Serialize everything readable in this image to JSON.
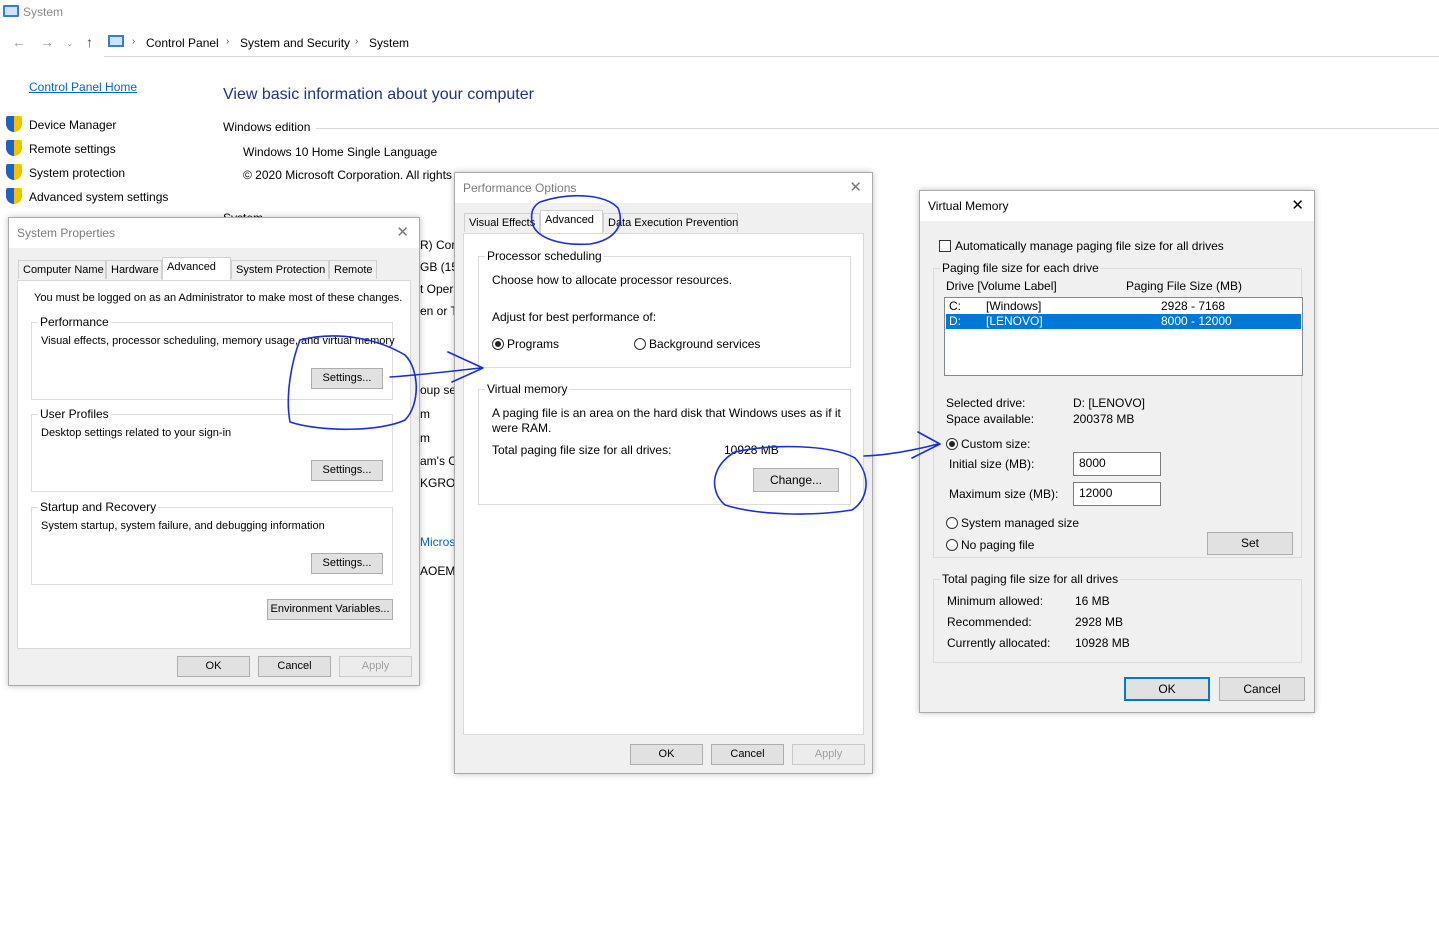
{
  "window": {
    "title": "System",
    "breadcrumb": [
      "Control Panel",
      "System and Security",
      "System"
    ],
    "breadcrumb_sep": "›"
  },
  "sidebar": {
    "home": "Control Panel Home",
    "items": [
      {
        "label": "Device Manager",
        "icon": "shield-icon"
      },
      {
        "label": "Remote settings",
        "icon": "shield-icon"
      },
      {
        "label": "System protection",
        "icon": "shield-icon"
      },
      {
        "label": "Advanced system settings",
        "icon": "shield-icon"
      }
    ]
  },
  "main": {
    "title": "View basic information about your computer",
    "windows_edition_label": "Windows edition",
    "edition": "Windows 10 Home Single Language",
    "copyright": "© 2020 Microsoft Corporation. All rights",
    "system_label": "System",
    "peek": [
      "R) Cor",
      "GB (15.",
      "t Opera",
      "en or T",
      "oup se",
      "m",
      "m",
      "am's C",
      "KGROU",
      "Microso",
      "AOEM"
    ]
  },
  "system_properties": {
    "title": "System Properties",
    "tabs": [
      "Computer Name",
      "Hardware",
      "Advanced",
      "System Protection",
      "Remote"
    ],
    "notice": "You must be logged on as an Administrator to make most of these changes.",
    "performance": {
      "label": "Performance",
      "desc": "Visual effects, processor scheduling, memory usage, and virtual memory",
      "button": "Settings..."
    },
    "user_profiles": {
      "label": "User Profiles",
      "desc": "Desktop settings related to your sign-in",
      "button": "Settings..."
    },
    "startup_recovery": {
      "label": "Startup and Recovery",
      "desc": "System startup, system failure, and debugging information",
      "button": "Settings..."
    },
    "env_button": "Environment Variables...",
    "ok": "OK",
    "cancel": "Cancel",
    "apply": "Apply"
  },
  "performance_options": {
    "title": "Performance Options",
    "tabs": [
      "Visual Effects",
      "Advanced",
      "Data Execution Prevention"
    ],
    "processor": {
      "label": "Processor scheduling",
      "desc": "Choose how to allocate processor resources.",
      "adjust": "Adjust for best performance of:",
      "opt_programs": "Programs",
      "opt_background": "Background services",
      "selected": "Programs"
    },
    "virtual_memory": {
      "label": "Virtual memory",
      "desc_line1": "A paging file is an area on the hard disk that Windows uses as if it",
      "desc_line2": "were RAM.",
      "total_label": "Total paging file size for all drives:",
      "total_value": "10928 MB",
      "change_button": "Change..."
    },
    "ok": "OK",
    "cancel": "Cancel",
    "apply": "Apply"
  },
  "virtual_memory": {
    "title": "Virtual Memory",
    "auto_manage": "Automatically manage paging file size for all drives",
    "auto_manage_checked": false,
    "group_each": "Paging file size for each drive",
    "col_drive": "Drive  [Volume Label]",
    "col_size": "Paging File Size (MB)",
    "drives": [
      {
        "drive": "C:",
        "label": "[Windows]",
        "size": "2928 - 7168",
        "selected": false
      },
      {
        "drive": "D:",
        "label": "[LENOVO]",
        "size": "8000 - 12000",
        "selected": true
      }
    ],
    "selected_drive_label": "Selected drive:",
    "selected_drive_value": "D:  [LENOVO]",
    "space_label": "Space available:",
    "space_value": "200378 MB",
    "custom_size": "Custom size:",
    "initial_label": "Initial size (MB):",
    "initial_value": "8000",
    "max_label": "Maximum size (MB):",
    "max_value": "12000",
    "system_managed": "System managed size",
    "no_paging": "No paging file",
    "selected_option": "Custom size",
    "set_button": "Set",
    "group_total": "Total paging file size for all drives",
    "min_label": "Minimum allowed:",
    "min_value": "16 MB",
    "rec_label": "Recommended:",
    "rec_value": "2928 MB",
    "cur_label": "Currently allocated:",
    "cur_value": "10928 MB",
    "ok": "OK",
    "cancel": "Cancel"
  },
  "colors": {
    "accent": "#0078d7",
    "link": "#0066cc",
    "title_blue": "#1e3287",
    "ink": "#1a2fd6"
  }
}
